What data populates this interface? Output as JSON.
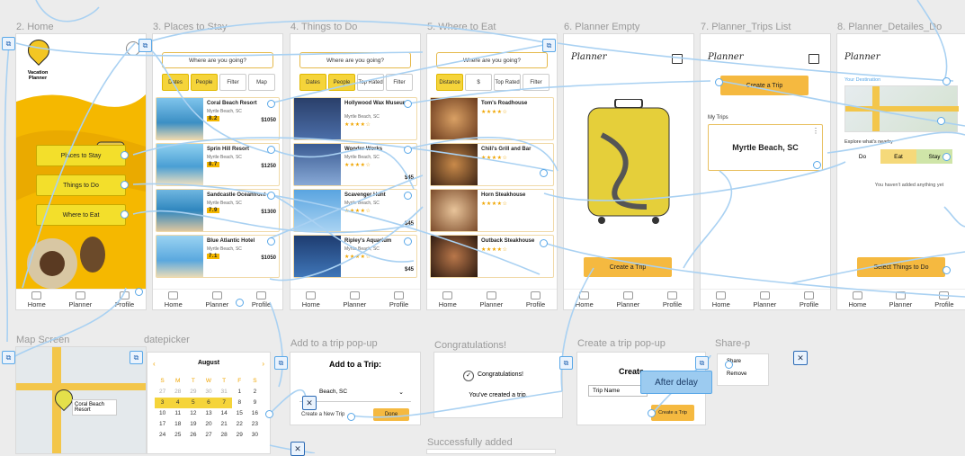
{
  "frame_labels": {
    "home": "2. Home",
    "places": "3. Places to Stay",
    "things": "4. Things to Do",
    "eat": "5. Where to Eat",
    "planner_empty": "6. Planner Empty",
    "planner_trips": "7. Planner_Trips List",
    "planner_details": "8. Planner_Detailes_Do",
    "map": "Map Screen",
    "datepicker": "datepicker",
    "add_trip": "Add to a trip pop-up",
    "congrats": "Congratulations!",
    "create_trip": "Create a trip pop-up",
    "share": "Share-p",
    "success": "Successfully added"
  },
  "nav": {
    "home": "Home",
    "planner": "Planner",
    "profile": "Profile"
  },
  "home": {
    "logo_line1": "Vacation",
    "logo_line2": "Planner",
    "buttons": [
      "Places to Stay",
      "Things to Do",
      "Where to Eat"
    ]
  },
  "search_placeholder": "Where are you going?",
  "places": {
    "chips": [
      "Dates",
      "People",
      "Filter",
      "Map"
    ],
    "cards": [
      {
        "title": "Coral Beach Resort",
        "sub": "Myrtle Beach, SC",
        "rating": "8.2",
        "price": "$1050"
      },
      {
        "title": "Sprin Hill Resort",
        "sub": "Myrtle Beach, SC",
        "rating": "8.7",
        "price": "$1250"
      },
      {
        "title": "Sandcastle Oceanfront",
        "sub": "Myrtle Beach, SC",
        "rating": "7.9",
        "price": "$1300"
      },
      {
        "title": "Blue Atlantic Hotel",
        "sub": "Myrtle Beach, SC",
        "rating": "7.1",
        "price": "$1050"
      }
    ]
  },
  "things": {
    "chips": [
      "Dates",
      "People",
      "Top Rated",
      "Filter"
    ],
    "cards": [
      {
        "title": "Hollywood Wax Museum",
        "sub": "Myrtle Beach, SC",
        "stars": "★★★★☆"
      },
      {
        "title": "Wonder Works",
        "sub": "Myrtle Beach, SC",
        "stars": "★★★★☆",
        "price": "$45"
      },
      {
        "title": "Scavenger Hunt",
        "sub": "Myrtle Beach, SC",
        "stars": "★★★★☆",
        "price": "$45"
      },
      {
        "title": "Ripley's Aquarium",
        "sub": "Myrtle Beach, SC",
        "stars": "★★★★☆",
        "price": "$45"
      }
    ]
  },
  "eat": {
    "chips": [
      "Distance",
      "$",
      "Top Rated",
      "Filter"
    ],
    "cards": [
      {
        "title": "Tom's Roadhouse",
        "stars": "★★★★☆"
      },
      {
        "title": "Chili's Grill and Bar",
        "stars": "★★★★☆"
      },
      {
        "title": "Horn Steakhouse",
        "stars": "★★★★☆"
      },
      {
        "title": "Outback Steakhouse",
        "stars": "★★★★☆"
      }
    ]
  },
  "planner": {
    "title": "Planner",
    "create_trip": "Create a Trip",
    "my_trips": "My Trips",
    "trip_name": "Myrtle Beach, SC",
    "your_destination": "Your Destination",
    "explore": "Explore what's nearby",
    "tabs": [
      "Do",
      "Eat",
      "Stay"
    ],
    "empty_msg": "You haven't added anything yet",
    "select_btn": "Select Things to Do"
  },
  "map": {
    "label": "Coral Beach Resort"
  },
  "datepicker": {
    "month": "August",
    "weekdays": [
      "S",
      "M",
      "T",
      "W",
      "T",
      "F",
      "S"
    ],
    "rows": [
      [
        "27",
        "28",
        "29",
        "30",
        "31",
        "1",
        "2"
      ],
      [
        "3",
        "4",
        "5",
        "6",
        "7",
        "8",
        "9"
      ],
      [
        "10",
        "11",
        "12",
        "13",
        "14",
        "15",
        "16"
      ],
      [
        "17",
        "18",
        "19",
        "20",
        "21",
        "22",
        "23"
      ],
      [
        "24",
        "25",
        "26",
        "27",
        "28",
        "29",
        "30"
      ]
    ]
  },
  "add_trip": {
    "heading": "Add to a Trip:",
    "select_value": "Beach, SC",
    "create_new": "Create a New Trip",
    "button": "Done"
  },
  "congrats": {
    "heading": "Congratulations!",
    "message": "You've created a trip."
  },
  "create_trip": {
    "heading": "Create",
    "field": "Trip Name",
    "button": "Create a Trip"
  },
  "after_delay": "After delay",
  "share": {
    "items": [
      "Share",
      "Remove"
    ]
  }
}
